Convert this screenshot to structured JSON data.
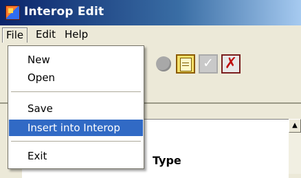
{
  "window": {
    "title": "Interop Edit"
  },
  "menubar": {
    "file": "File",
    "edit": "Edit",
    "help": "Help"
  },
  "file_menu": {
    "items": [
      "New",
      "Open",
      "Save",
      "Insert into Interop",
      "Exit"
    ],
    "selected": "Insert into Interop"
  },
  "content": {
    "type_label": "Type"
  },
  "colors": {
    "title_start": "#0a246a",
    "title_end": "#a6caf0",
    "selection": "#316ac5",
    "face": "#ece9d8"
  }
}
